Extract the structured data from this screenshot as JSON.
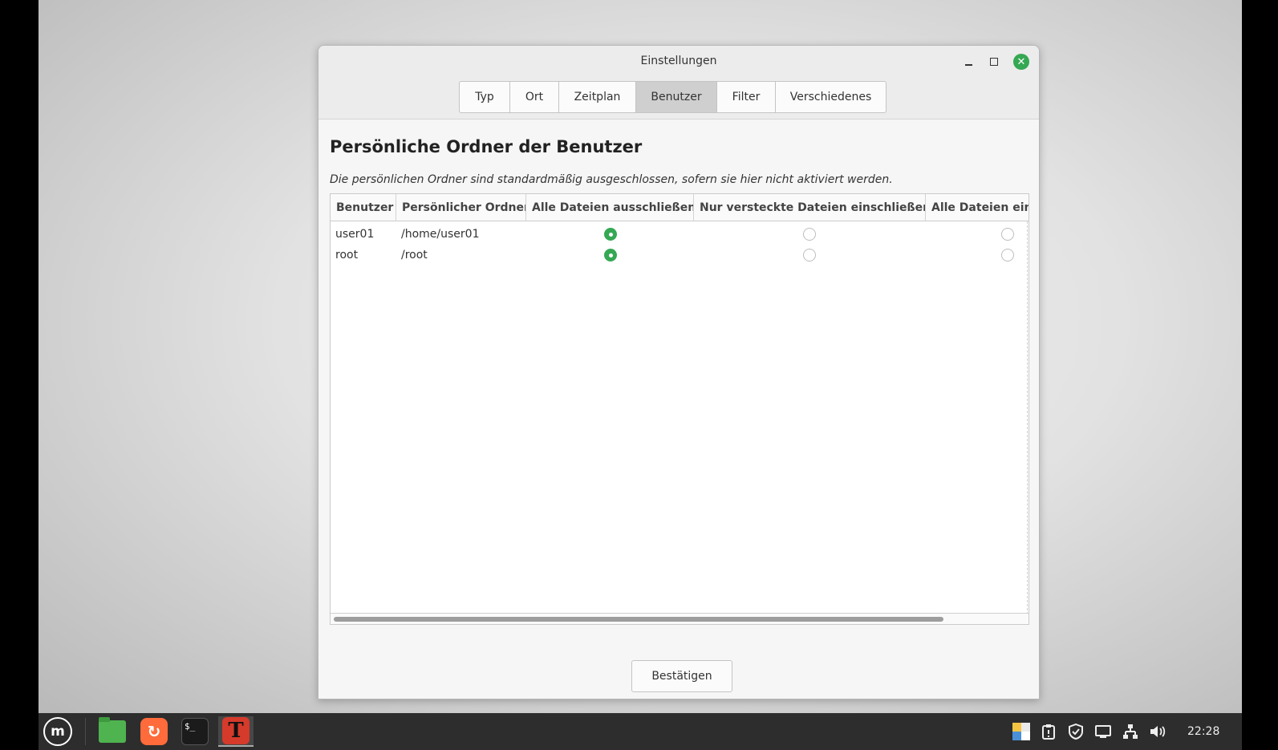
{
  "window": {
    "title": "Einstellungen",
    "close_glyph": "✕"
  },
  "tabs": [
    {
      "label": "Typ",
      "active": false
    },
    {
      "label": "Ort",
      "active": false
    },
    {
      "label": "Zeitplan",
      "active": false
    },
    {
      "label": "Benutzer",
      "active": true
    },
    {
      "label": "Filter",
      "active": false
    },
    {
      "label": "Verschiedenes",
      "active": false
    }
  ],
  "section": {
    "heading": "Persönliche Ordner der Benutzer",
    "description": "Die persönlichen Ordner sind standardmäßig ausgeschlossen, sofern sie hier nicht aktiviert werden."
  },
  "table": {
    "columns": [
      "Benutzer",
      "Persönlicher Ordner",
      "Alle Dateien ausschließen",
      "Nur versteckte Dateien einschließen",
      "Alle Dateien ein"
    ],
    "rows": [
      {
        "user": "user01",
        "folder": "/home/user01",
        "selected": 0
      },
      {
        "user": "root",
        "folder": "/root",
        "selected": 0
      }
    ]
  },
  "confirm_label": "Bestätigen",
  "taskbar": {
    "menu_glyph": "m",
    "browser_glyph": "↻",
    "terminal_glyph": "$_",
    "app_glyph": "T",
    "clock": "22:28"
  },
  "colors": {
    "accent": "#35a853",
    "taskbar": "#2d2d2d"
  }
}
